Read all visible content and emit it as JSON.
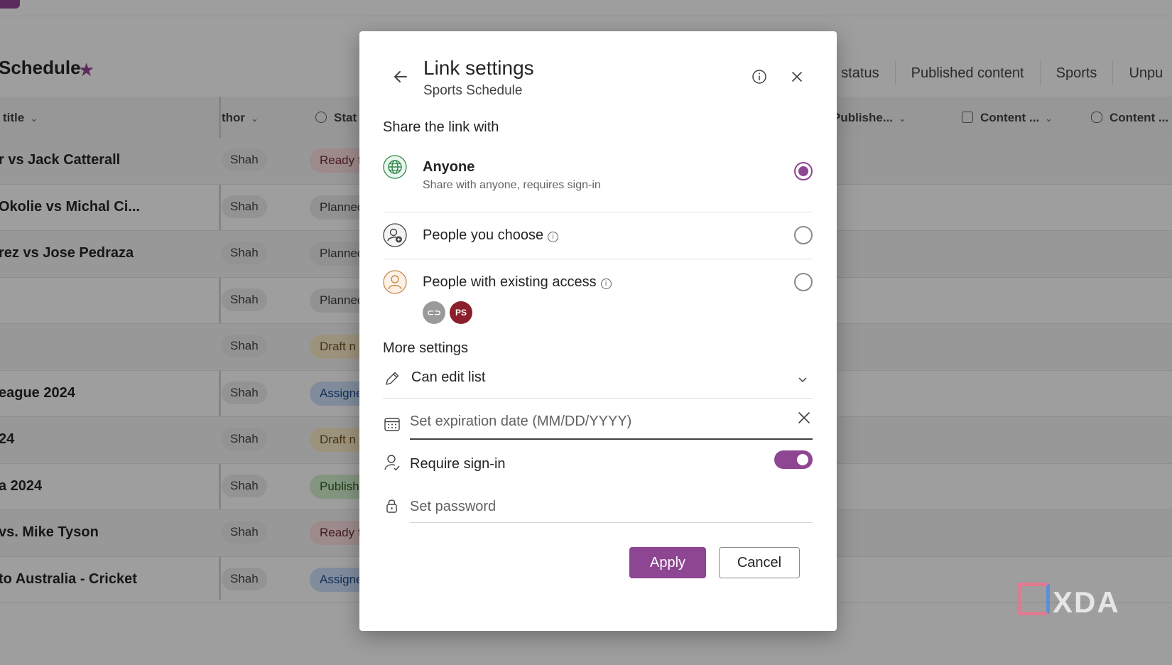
{
  "background": {
    "page_title": "Schedule",
    "view_tabs": [
      "nt status",
      "Published content",
      "Sports",
      "Unpu"
    ],
    "columns": {
      "title": "title",
      "author": "thor",
      "status": "Stat",
      "published": "Publishe...",
      "content1": "Content ...",
      "content2": "Content ..."
    },
    "rows": [
      {
        "title": "r vs Jack Catterall",
        "author": "Shah",
        "status": "Ready f"
      },
      {
        "title": "Okolie vs Michal Ci...",
        "author": "Shah",
        "status": "Planned"
      },
      {
        "title": "rez vs Jose Pedraza",
        "author": "Shah",
        "status": "Planned"
      },
      {
        "title": "",
        "author": "Shah",
        "status": "Planned"
      },
      {
        "title": "",
        "author": "Shah",
        "status": "Draft n"
      },
      {
        "title": "eague 2024",
        "author": "Shah",
        "status": "Assigne"
      },
      {
        "title": "24",
        "author": "Shah",
        "status": "Draft n"
      },
      {
        "title": "a 2024",
        "author": "Shah",
        "status": "Publish"
      },
      {
        "title": "vs. Mike Tyson",
        "author": "Shah",
        "status": "Ready f"
      },
      {
        "title": "to Australia - Cricket",
        "author": "Shah",
        "status": "Assigne"
      }
    ],
    "watermark": "XDA"
  },
  "dialog": {
    "title": "Link settings",
    "subtitle": "Sports Schedule",
    "share_label": "Share the link with",
    "options": [
      {
        "label": "Anyone",
        "description": "Share with anyone, requires sign-in",
        "selected": true
      },
      {
        "label": "People you choose",
        "selected": false
      },
      {
        "label": "People with existing access",
        "selected": false,
        "avatar_initials": "PS"
      }
    ],
    "more_settings_label": "More settings",
    "permission": "Can edit list",
    "expiration_placeholder": "Set expiration date (MM/DD/YYYY)",
    "require_signin_label": "Require sign-in",
    "require_signin_on": true,
    "password_placeholder": "Set password",
    "apply_label": "Apply",
    "cancel_label": "Cancel"
  },
  "colors": {
    "accent": "#8e4592",
    "avatar_ps": "#8b1f2b"
  },
  "icons": [
    "arrow-left-icon",
    "info-icon",
    "close-icon",
    "globe-icon",
    "person-add-icon",
    "person-icon",
    "link-icon",
    "pencil-icon",
    "chevron-down-icon",
    "calendar-icon",
    "person-check-icon",
    "lock-icon",
    "star-icon"
  ]
}
